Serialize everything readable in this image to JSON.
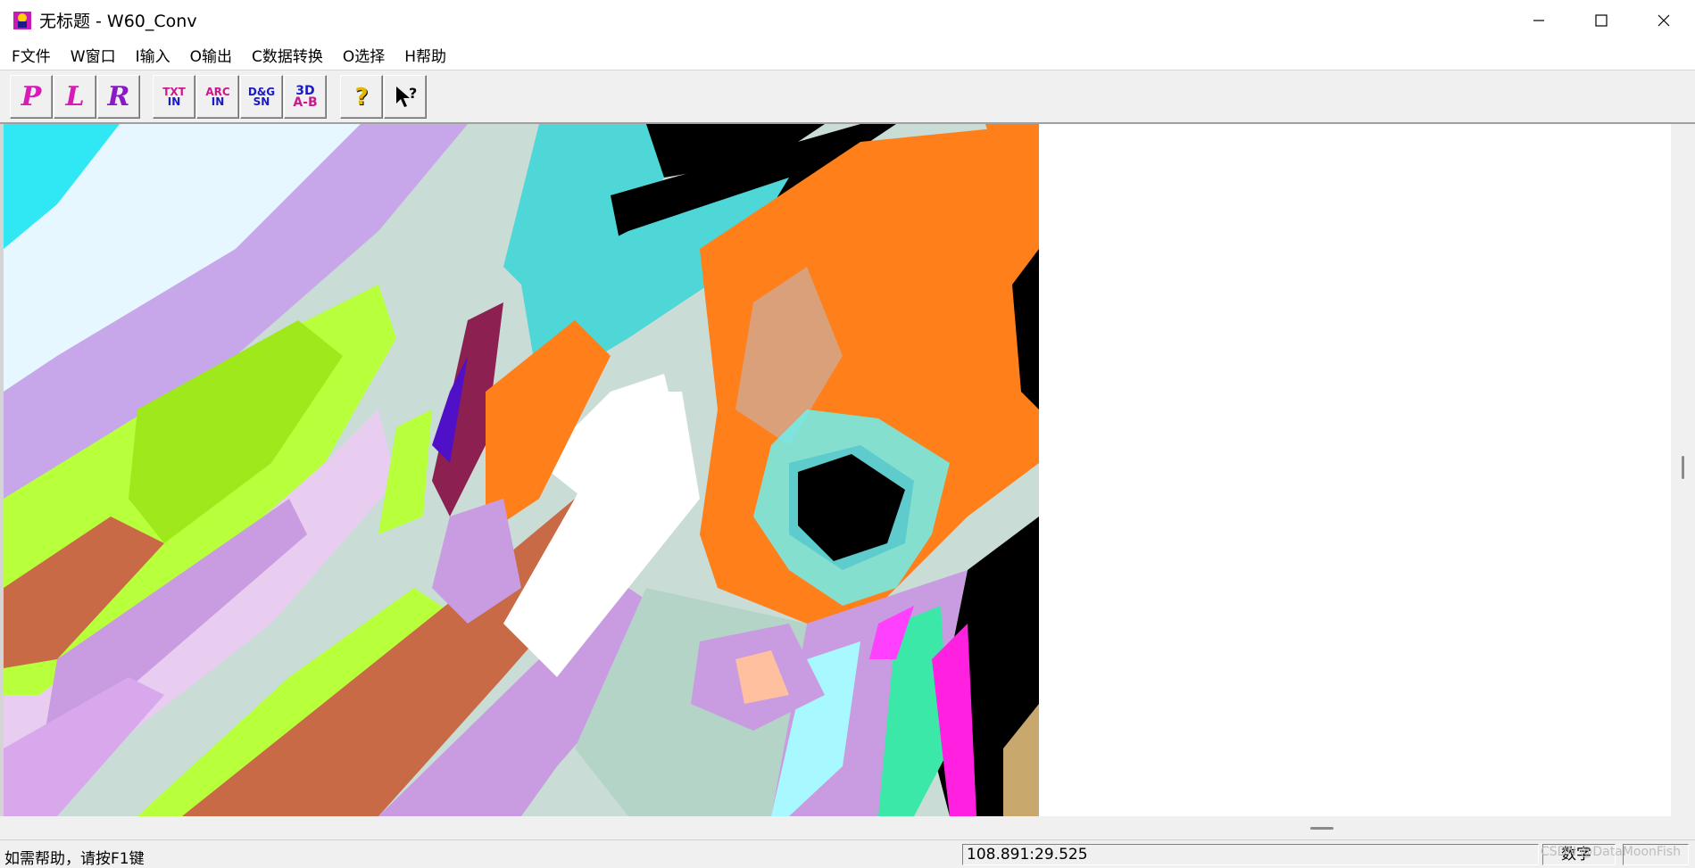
{
  "window": {
    "title": "无标题 - W60_Conv",
    "minimize_icon": "minimize-icon",
    "maximize_icon": "maximize-icon",
    "close_icon": "close-icon"
  },
  "menu": [
    "F文件",
    "W窗口",
    "I输入",
    "O输出",
    "C数据转换",
    "O选择",
    "H帮助"
  ],
  "toolbar": {
    "buttons": [
      {
        "icon": "point-file-icon",
        "glyph": "P"
      },
      {
        "icon": "line-file-icon",
        "glyph": "L"
      },
      {
        "icon": "region-file-icon",
        "glyph": "R"
      },
      {
        "icon": "txt-input-icon",
        "lines": [
          "TXT",
          "IN"
        ]
      },
      {
        "icon": "arc-input-icon",
        "lines": [
          "ARC",
          "IN"
        ]
      },
      {
        "icon": "dxg-input-icon",
        "lines": [
          "D&G",
          "SN"
        ]
      },
      {
        "icon": "3d-convert-icon",
        "lines": [
          "3D",
          "A-B"
        ]
      },
      {
        "icon": "help-icon",
        "glyph": "?"
      },
      {
        "icon": "context-help-icon",
        "glyph": "?"
      }
    ]
  },
  "status": {
    "help_text": "如需帮助，请按F1键",
    "coordinates": "108.891:29.525",
    "mode": "数字"
  },
  "watermark": "CSDN @DataMoonFish",
  "colors": {
    "titlebar": "#ffffff",
    "chrome": "#f0f0f0",
    "canvas": "#ffffff",
    "map_orange": "#ff7f1a",
    "map_lime": "#b8ff3c",
    "map_sienna": "#c86a46",
    "map_lavender": "#c99be0",
    "map_sage": "#b4d4c8",
    "map_cyan": "#6ff0f0",
    "map_black": "#000000"
  }
}
